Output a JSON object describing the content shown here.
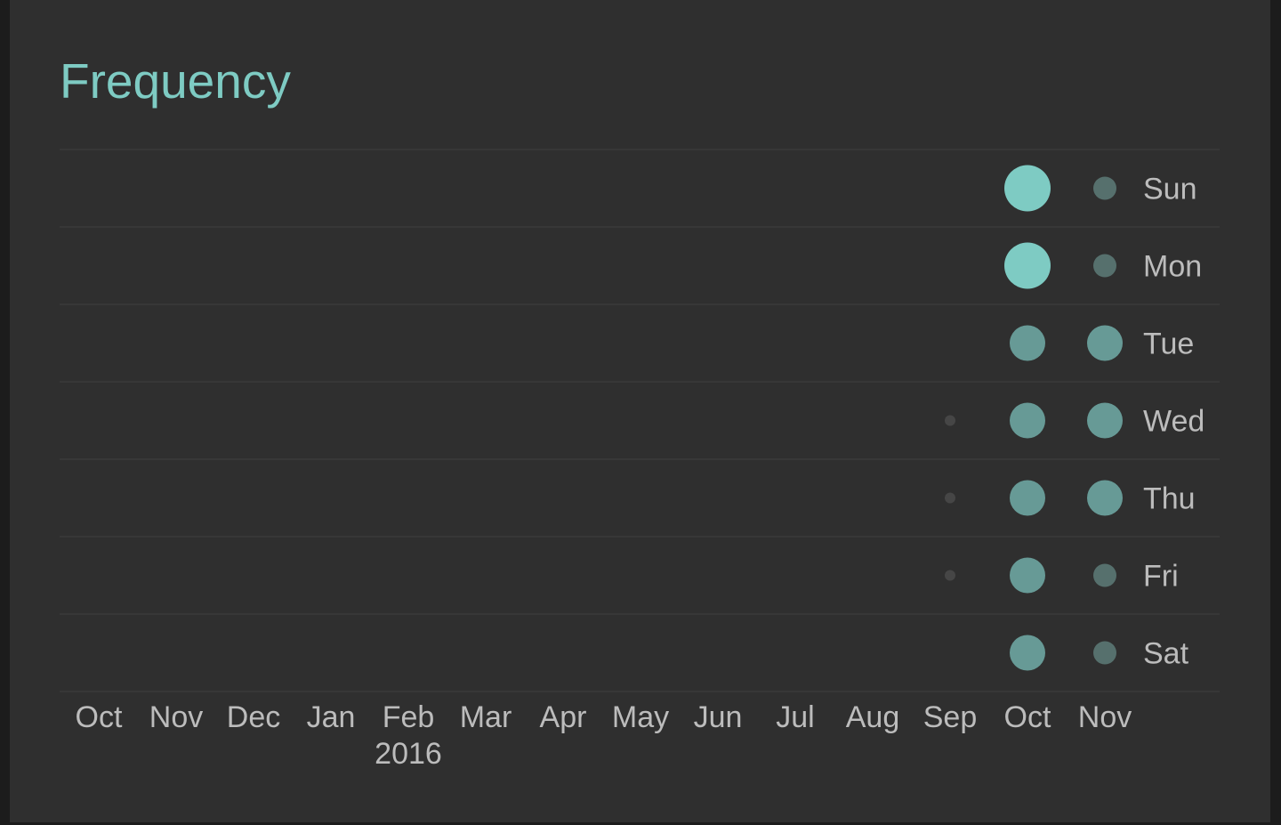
{
  "chart_data": {
    "type": "scatter",
    "title": "Frequency",
    "rows": [
      "Sun",
      "Mon",
      "Tue",
      "Wed",
      "Thu",
      "Fri",
      "Sat"
    ],
    "columns": [
      "Oct",
      "Nov",
      "Dec",
      "Jan",
      "Feb",
      "Mar",
      "Apr",
      "May",
      "Jun",
      "Jul",
      "Aug",
      "Sep",
      "Oct",
      "Nov"
    ],
    "year_labels": [
      {
        "column": 4,
        "label": "2016"
      }
    ],
    "max_value": 3,
    "points": [
      {
        "row": 0,
        "col": 12,
        "value": 3
      },
      {
        "row": 0,
        "col": 13,
        "value": 1
      },
      {
        "row": 1,
        "col": 12,
        "value": 3
      },
      {
        "row": 1,
        "col": 13,
        "value": 1
      },
      {
        "row": 2,
        "col": 12,
        "value": 2
      },
      {
        "row": 2,
        "col": 13,
        "value": 2
      },
      {
        "row": 3,
        "col": 11,
        "value": 0.2
      },
      {
        "row": 3,
        "col": 12,
        "value": 2
      },
      {
        "row": 3,
        "col": 13,
        "value": 2
      },
      {
        "row": 4,
        "col": 11,
        "value": 0.2
      },
      {
        "row": 4,
        "col": 12,
        "value": 2
      },
      {
        "row": 4,
        "col": 13,
        "value": 2
      },
      {
        "row": 5,
        "col": 11,
        "value": 0.2
      },
      {
        "row": 5,
        "col": 12,
        "value": 2
      },
      {
        "row": 5,
        "col": 13,
        "value": 1
      },
      {
        "row": 6,
        "col": 12,
        "value": 2
      },
      {
        "row": 6,
        "col": 13,
        "value": 1
      }
    ],
    "grid": true,
    "colors": {
      "accent": "#7ecbc3",
      "level_2": "#679a96",
      "level_1": "#56706d",
      "minimal": "#464646",
      "grid": "#3a3a3a",
      "label": "#bcbcbc"
    }
  }
}
